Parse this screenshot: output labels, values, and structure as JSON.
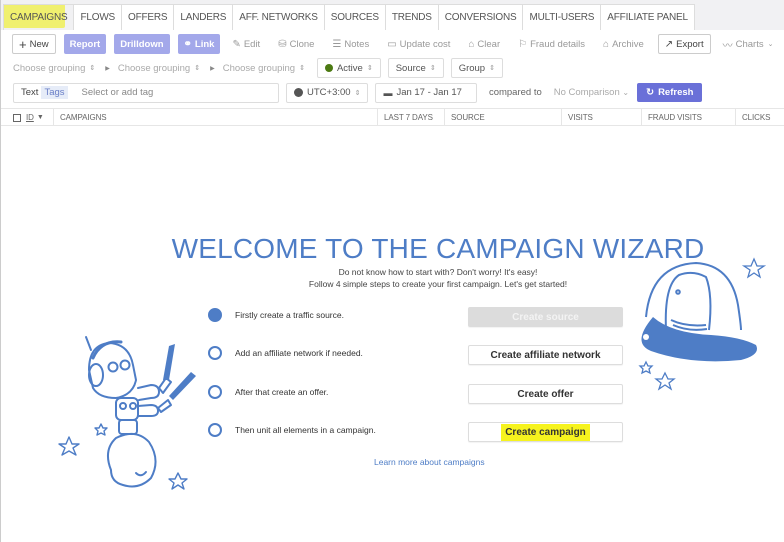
{
  "tabs": [
    {
      "label": "CAMPAIGNS",
      "active": true
    },
    {
      "label": "FLOWS"
    },
    {
      "label": "OFFERS"
    },
    {
      "label": "LANDERS"
    },
    {
      "label": "AFF. NETWORKS"
    },
    {
      "label": "SOURCES"
    },
    {
      "label": "TRENDS"
    },
    {
      "label": "CONVERSIONS"
    },
    {
      "label": "MULTI-USERS"
    },
    {
      "label": "AFFILIATE PANEL"
    }
  ],
  "toolbar": {
    "new": "New",
    "report": "Report",
    "drilldown": "Drilldown",
    "link": "Link",
    "edit": "Edit",
    "clone": "Clone",
    "notes": "Notes",
    "update_cost": "Update cost",
    "clear": "Clear",
    "fraud_details": "Fraud details",
    "archive": "Archive",
    "export": "Export",
    "charts": "Charts"
  },
  "grouping": {
    "placeholders": [
      "Choose grouping",
      "Choose grouping",
      "Choose grouping"
    ],
    "status": "Active",
    "source": "Source",
    "group": "Group",
    "status_color": "#4c7a12"
  },
  "filters": {
    "text_label": "Text",
    "tags_label": "Tags",
    "tag_placeholder": "Select or add tag",
    "timezone": "UTC+3:00",
    "date_range": "Jan 17 - Jan 17",
    "compared_to": "compared to",
    "comparison": "No Comparison",
    "refresh": "Refresh"
  },
  "table": {
    "columns": [
      "ID",
      "CAMPAIGNS",
      "LAST 7 DAYS",
      "SOURCE",
      "VISITS",
      "FRAUD VISITS",
      "CLICKS"
    ]
  },
  "wizard": {
    "title": "WELCOME TO THE CAMPAIGN WIZARD",
    "subtitle1": "Do not know how to start with? Don't worry! It's easy!",
    "subtitle2": "Follow 4 simple steps to create your first campaign. Let's get started!",
    "steps": [
      {
        "text": "Firstly create a traffic source.",
        "button": "Create source",
        "done": true
      },
      {
        "text": "Add an affiliate network if needed.",
        "button": "Create affiliate network",
        "done": false
      },
      {
        "text": "After that create an offer.",
        "button": "Create offer",
        "done": false
      },
      {
        "text": "Then unit all elements in a campaign.",
        "button": "Create campaign",
        "done": false
      }
    ],
    "learn_more": "Learn more about campaigns",
    "accent_color": "#4e7dc6"
  }
}
